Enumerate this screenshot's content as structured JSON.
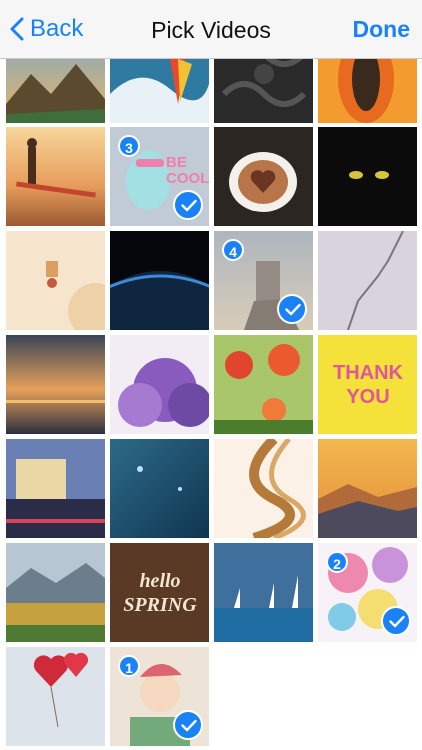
{
  "nav": {
    "back_label": "Back",
    "title": "Pick Videos",
    "done_label": "Done"
  },
  "thumbnails": [
    {
      "name": "thumb-mountain-lake",
      "selected": false
    },
    {
      "name": "thumb-windsurfer",
      "selected": false
    },
    {
      "name": "thumb-dark-ornament-pattern",
      "selected": false
    },
    {
      "name": "thumb-papaya",
      "selected": false
    },
    {
      "name": "thumb-surfer-sunset",
      "selected": false
    },
    {
      "name": "thumb-be-cool-dinosaur",
      "selected": true,
      "order": "3",
      "text": "BE COOL"
    },
    {
      "name": "thumb-heart-latte",
      "selected": false
    },
    {
      "name": "thumb-black-cat",
      "selected": false
    },
    {
      "name": "thumb-christmas-ornaments",
      "selected": false
    },
    {
      "name": "thumb-earth-from-space",
      "selected": false
    },
    {
      "name": "thumb-castle-on-cliff",
      "selected": true,
      "order": "4"
    },
    {
      "name": "thumb-cracked-wall",
      "selected": false
    },
    {
      "name": "thumb-sea-sunset",
      "selected": false
    },
    {
      "name": "thumb-lilac-tree",
      "selected": false
    },
    {
      "name": "thumb-poppy-flowers",
      "selected": false
    },
    {
      "name": "thumb-thank-you-lettering",
      "selected": false,
      "text": "THANK YOU"
    },
    {
      "name": "thumb-city-at-night",
      "selected": false
    },
    {
      "name": "thumb-blue-bokeh-sky",
      "selected": false
    },
    {
      "name": "thumb-golden-smoke",
      "selected": false
    },
    {
      "name": "thumb-misty-mountains",
      "selected": false
    },
    {
      "name": "thumb-alpine-valley",
      "selected": false
    },
    {
      "name": "thumb-hello-spring-wood",
      "selected": false,
      "text": "hello SPRING"
    },
    {
      "name": "thumb-sailboats",
      "selected": false
    },
    {
      "name": "thumb-striped-balloons",
      "selected": true,
      "order": "2"
    },
    {
      "name": "thumb-red-heart-balloons",
      "selected": false
    },
    {
      "name": "thumb-kids-christmas",
      "selected": true,
      "order": "1"
    }
  ],
  "colors": {
    "accent": "#1a82f7",
    "navbar_bg": "#f6f6f7"
  }
}
